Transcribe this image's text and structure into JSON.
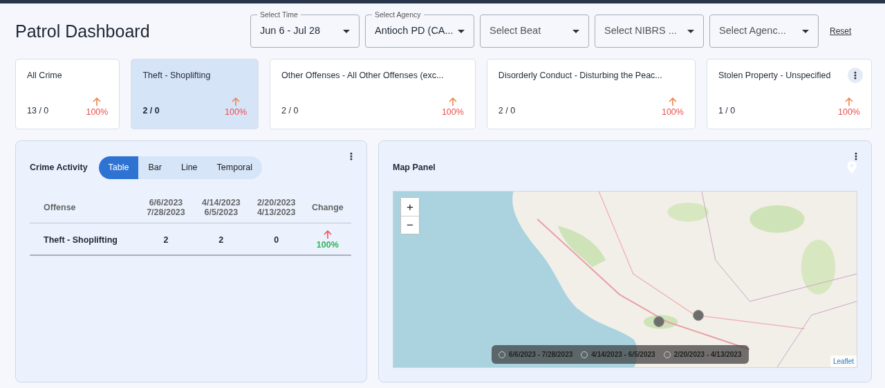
{
  "title": "Patrol Dashboard",
  "filters": [
    {
      "label": "Select Time",
      "value": "Jun 6 - Jul 28"
    },
    {
      "label": "Select Agency",
      "value": "Antioch PD (CA..."
    },
    {
      "placeholder": "Select Beat"
    },
    {
      "placeholder": "Select NIBRS ..."
    },
    {
      "placeholder": "Select Agenc..."
    }
  ],
  "reset": "Reset",
  "summary_cards": [
    {
      "title": "All Crime",
      "count": "13 / 0",
      "change": "100%",
      "increase": true,
      "selected": false,
      "show_menu": false
    },
    {
      "title": "Theft - Shoplifting",
      "count": "2 / 0",
      "change": "100%",
      "increase": true,
      "selected": true,
      "show_menu": false
    },
    {
      "title": "Other Offenses - All Other Offenses (exc...",
      "count": "2 / 0",
      "change": "100%",
      "increase": true,
      "selected": false,
      "show_menu": false
    },
    {
      "title": "Disorderly Conduct - Disturbing the Peac...",
      "count": "2 / 0",
      "change": "100%",
      "increase": true,
      "selected": false,
      "show_menu": false
    },
    {
      "title": "Stolen Property - Unspecified",
      "count": "1 / 0",
      "change": "100%",
      "increase": true,
      "selected": false,
      "show_menu": true
    }
  ],
  "crime_activity": {
    "title": "Crime Activity",
    "tabs": [
      {
        "label": "Table",
        "selected": true
      },
      {
        "label": "Bar",
        "selected": false
      },
      {
        "label": "Line",
        "selected": false
      },
      {
        "label": "Temporal",
        "selected": false
      }
    ],
    "table": {
      "columns": [
        [
          "Offense"
        ],
        [
          "6/6/2023",
          "7/28/2023"
        ],
        [
          "4/14/2023",
          "6/5/2023"
        ],
        [
          "2/20/2023",
          "4/13/2023"
        ],
        [
          "Change"
        ]
      ],
      "rows": [
        {
          "offense": "Theft - Shoplifting",
          "values": [
            "2",
            "2",
            "0"
          ],
          "change": "100%",
          "increase": true
        }
      ]
    }
  },
  "map_panel": {
    "title": "Map Panel",
    "zoom_in": "+",
    "zoom_out": "−",
    "attribution": "Leaflet",
    "legend": [
      {
        "label": "6/6/2023 - 7/28/2023",
        "selected": false
      },
      {
        "label": "4/14/2023 - 6/5/2023",
        "selected": false
      },
      {
        "label": "2/20/2023 - 4/13/2023",
        "selected": false
      }
    ]
  }
}
